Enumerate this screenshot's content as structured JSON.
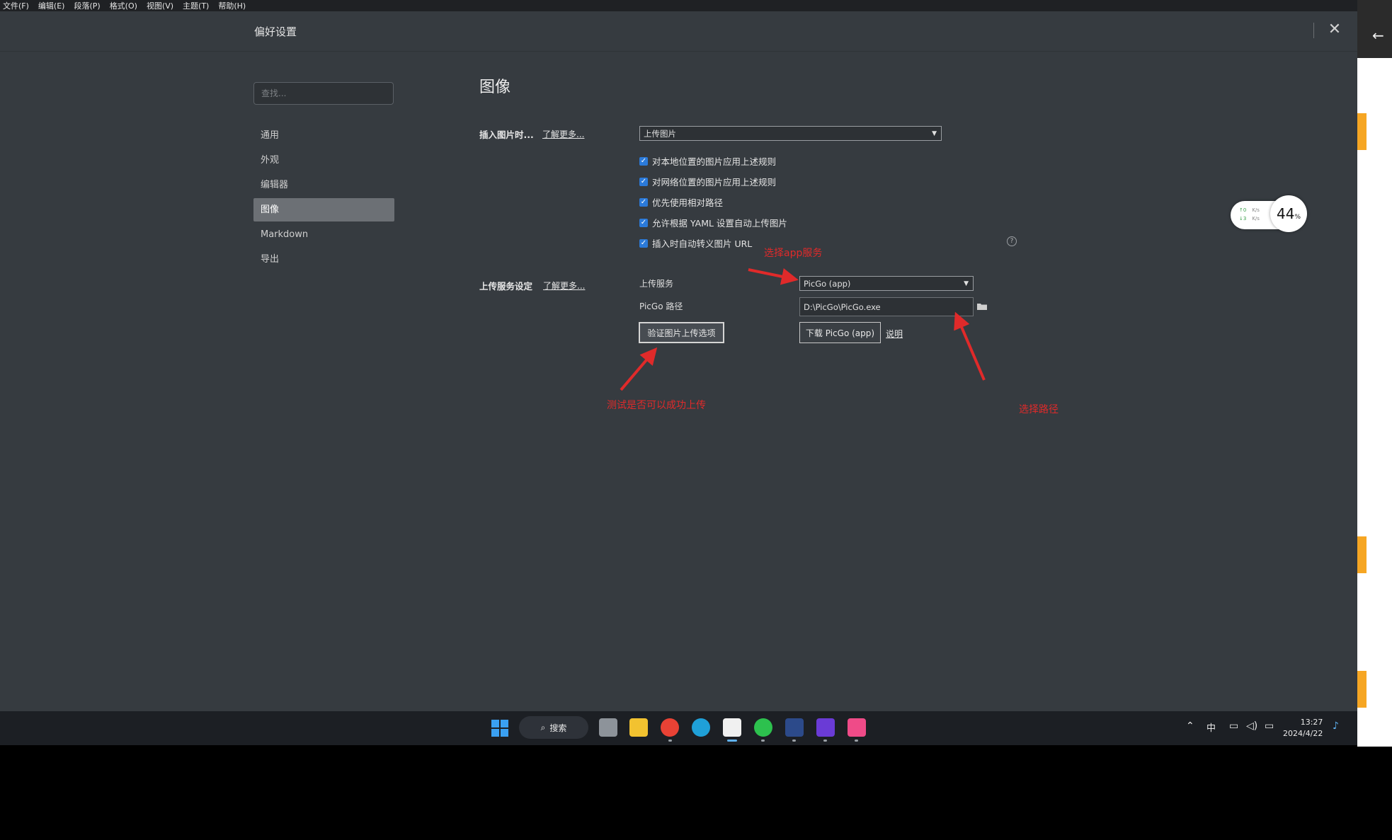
{
  "menubar": [
    "文件(F)",
    "编辑(E)",
    "段落(P)",
    "格式(O)",
    "视图(V)",
    "主题(T)",
    "帮助(H)"
  ],
  "header": {
    "title": "偏好设置"
  },
  "search": {
    "placeholder": "查找..."
  },
  "nav": {
    "items": [
      {
        "label": "通用",
        "active": false
      },
      {
        "label": "外观",
        "active": false
      },
      {
        "label": "编辑器",
        "active": false
      },
      {
        "label": "图像",
        "active": true
      },
      {
        "label": "Markdown",
        "active": false
      },
      {
        "label": "导出",
        "active": false
      }
    ]
  },
  "main": {
    "title": "图像",
    "insert": {
      "label": "插入图片时...",
      "learn_more": "了解更多...",
      "select_value": "上传图片",
      "checkboxes": [
        {
          "label": "对本地位置的图片应用上述规则",
          "checked": true
        },
        {
          "label": "对网络位置的图片应用上述规则",
          "checked": true
        },
        {
          "label": "优先使用相对路径",
          "checked": true
        },
        {
          "label": "允许根据 YAML 设置自动上传图片",
          "checked": true
        },
        {
          "label": "插入时自动转义图片 URL",
          "checked": true
        }
      ]
    },
    "upload": {
      "label": "上传服务设定",
      "learn_more": "了解更多...",
      "service_label": "上传服务",
      "service_value": "PicGo (app)",
      "path_label": "PicGo 路径",
      "path_value": "D:\\PicGo\\PicGo.exe",
      "verify_button": "验证图片上传选项",
      "download_button": "下载 PicGo (app)",
      "doc_link": "说明"
    }
  },
  "annotations": {
    "select_app": "选择app服务",
    "test_upload": "测试是否可以成功上传",
    "select_path": "选择路径"
  },
  "netmon": {
    "up": "0",
    "down": "3",
    "unit": "K/s",
    "cpu": "44",
    "cpu_unit": "%"
  },
  "taskbar": {
    "search_label": "搜索",
    "ime": "中",
    "time": "13:27",
    "date": "2024/4/22"
  },
  "colors": {
    "accent": "#2b7ad9",
    "annotation": "#e02a2a",
    "app_bg": "#363b40"
  }
}
